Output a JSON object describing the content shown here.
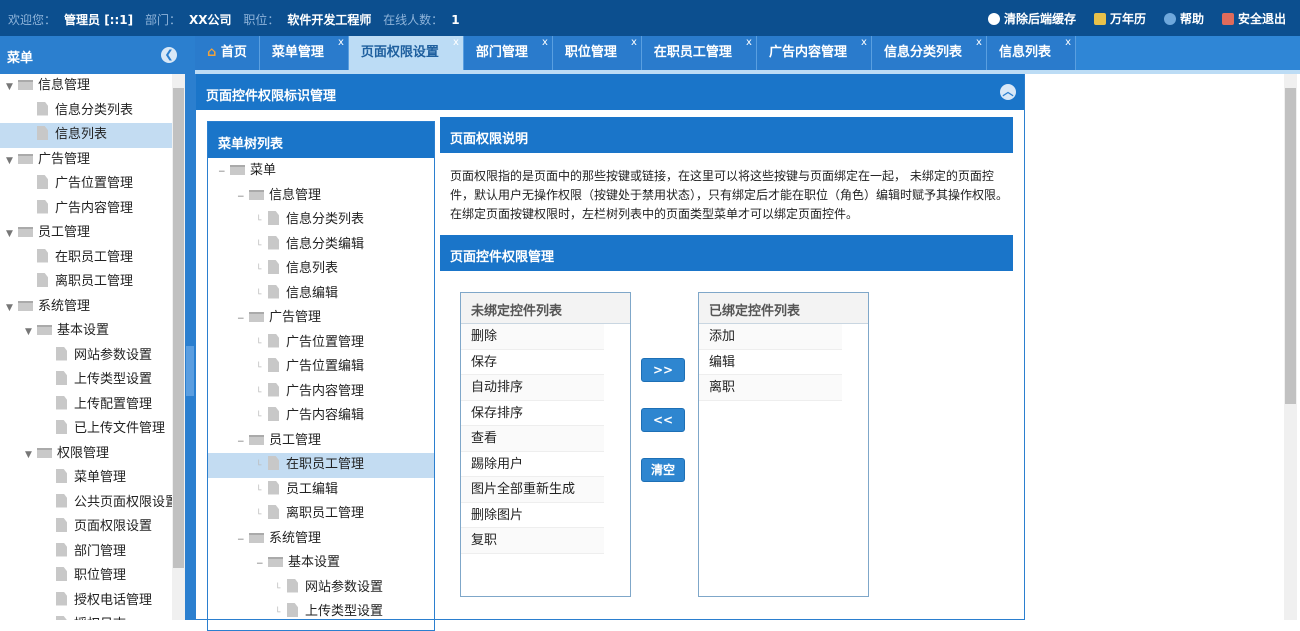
{
  "topbar": {
    "welcome_label": "欢迎您：",
    "user": "管理员 [::1]",
    "dept_label": "部门：",
    "dept": "XX公司",
    "pos_label": "职位：",
    "pos": "软件开发工程师",
    "online_label": "在线人数：",
    "online": "1",
    "actions": [
      {
        "label": "清除后端缓存",
        "icon": "clear-cache-icon"
      },
      {
        "label": "万年历",
        "icon": "calendar-icon"
      },
      {
        "label": "帮助",
        "icon": "help-icon"
      },
      {
        "label": "安全退出",
        "icon": "logout-icon"
      }
    ]
  },
  "sidebar": {
    "title": "菜单",
    "items": [
      {
        "label": "信息管理",
        "level": 0,
        "type": "folder"
      },
      {
        "label": "信息分类列表",
        "level": 1,
        "type": "file"
      },
      {
        "label": "信息列表",
        "level": 1,
        "type": "file",
        "selected": true
      },
      {
        "label": "广告管理",
        "level": 0,
        "type": "folder"
      },
      {
        "label": "广告位置管理",
        "level": 1,
        "type": "file"
      },
      {
        "label": "广告内容管理",
        "level": 1,
        "type": "file"
      },
      {
        "label": "员工管理",
        "level": 0,
        "type": "folder"
      },
      {
        "label": "在职员工管理",
        "level": 1,
        "type": "file"
      },
      {
        "label": "离职员工管理",
        "level": 1,
        "type": "file"
      },
      {
        "label": "系统管理",
        "level": 0,
        "type": "folder"
      },
      {
        "label": "基本设置",
        "level": 1,
        "type": "folder"
      },
      {
        "label": "网站参数设置",
        "level": 2,
        "type": "file"
      },
      {
        "label": "上传类型设置",
        "level": 2,
        "type": "file"
      },
      {
        "label": "上传配置管理",
        "level": 2,
        "type": "file"
      },
      {
        "label": "已上传文件管理",
        "level": 2,
        "type": "file"
      },
      {
        "label": "权限管理",
        "level": 1,
        "type": "folder"
      },
      {
        "label": "菜单管理",
        "level": 2,
        "type": "file"
      },
      {
        "label": "公共页面权限设置",
        "level": 2,
        "type": "file"
      },
      {
        "label": "页面权限设置",
        "level": 2,
        "type": "file"
      },
      {
        "label": "部门管理",
        "level": 2,
        "type": "file"
      },
      {
        "label": "职位管理",
        "level": 2,
        "type": "file"
      },
      {
        "label": "授权电话管理",
        "level": 2,
        "type": "file"
      },
      {
        "label": "授权日志",
        "level": 2,
        "type": "file"
      }
    ]
  },
  "tabs": [
    {
      "label": "首页",
      "home": true
    },
    {
      "label": "菜单管理"
    },
    {
      "label": "页面权限设置",
      "active": true
    },
    {
      "label": "部门管理"
    },
    {
      "label": "职位管理"
    },
    {
      "label": "在职员工管理"
    },
    {
      "label": "广告内容管理"
    },
    {
      "label": "信息分类列表"
    },
    {
      "label": "信息列表"
    }
  ],
  "tab_close": "x",
  "panel": {
    "title": "页面控件权限标识管理",
    "tree_title": "菜单树列表",
    "tree": [
      {
        "label": "菜单",
        "level": 0,
        "type": "folder"
      },
      {
        "label": "信息管理",
        "level": 1,
        "type": "folder"
      },
      {
        "label": "信息分类列表",
        "level": 2,
        "type": "file"
      },
      {
        "label": "信息分类编辑",
        "level": 2,
        "type": "file"
      },
      {
        "label": "信息列表",
        "level": 2,
        "type": "file"
      },
      {
        "label": "信息编辑",
        "level": 2,
        "type": "file"
      },
      {
        "label": "广告管理",
        "level": 1,
        "type": "folder"
      },
      {
        "label": "广告位置管理",
        "level": 2,
        "type": "file"
      },
      {
        "label": "广告位置编辑",
        "level": 2,
        "type": "file"
      },
      {
        "label": "广告内容管理",
        "level": 2,
        "type": "file"
      },
      {
        "label": "广告内容编辑",
        "level": 2,
        "type": "file"
      },
      {
        "label": "员工管理",
        "level": 1,
        "type": "folder"
      },
      {
        "label": "在职员工管理",
        "level": 2,
        "type": "file",
        "selected": true
      },
      {
        "label": "员工编辑",
        "level": 2,
        "type": "file"
      },
      {
        "label": "离职员工管理",
        "level": 2,
        "type": "file"
      },
      {
        "label": "系统管理",
        "level": 1,
        "type": "folder"
      },
      {
        "label": "基本设置",
        "level": 2,
        "type": "folder"
      },
      {
        "label": "网站参数设置",
        "level": 3,
        "type": "file"
      },
      {
        "label": "上传类型设置",
        "level": 3,
        "type": "file"
      }
    ],
    "desc_title": "页面权限说明",
    "desc": "页面权限指的是页面中的那些按键或链接，在这里可以将这些按键与页面绑定在一起， 未绑定的页面控件，默认用户无操作权限（按键处于禁用状态），只有绑定后才能在职位（角色）编辑时赋予其操作权限。 在绑定页面按键权限时，左栏树列表中的页面类型菜单才可以绑定页面控件。",
    "mgmt_title": "页面控件权限管理",
    "unbound_title": "未绑定控件列表",
    "unbound": [
      "删除",
      "保存",
      "自动排序",
      "保存排序",
      "查看",
      "踢除用户",
      "图片全部重新生成",
      "删除图片",
      "复职"
    ],
    "bound_title": "已绑定控件列表",
    "bound": [
      "添加",
      "编辑",
      "离职"
    ],
    "btn_add": ">>",
    "btn_remove": "<<",
    "btn_clear": "清空"
  }
}
